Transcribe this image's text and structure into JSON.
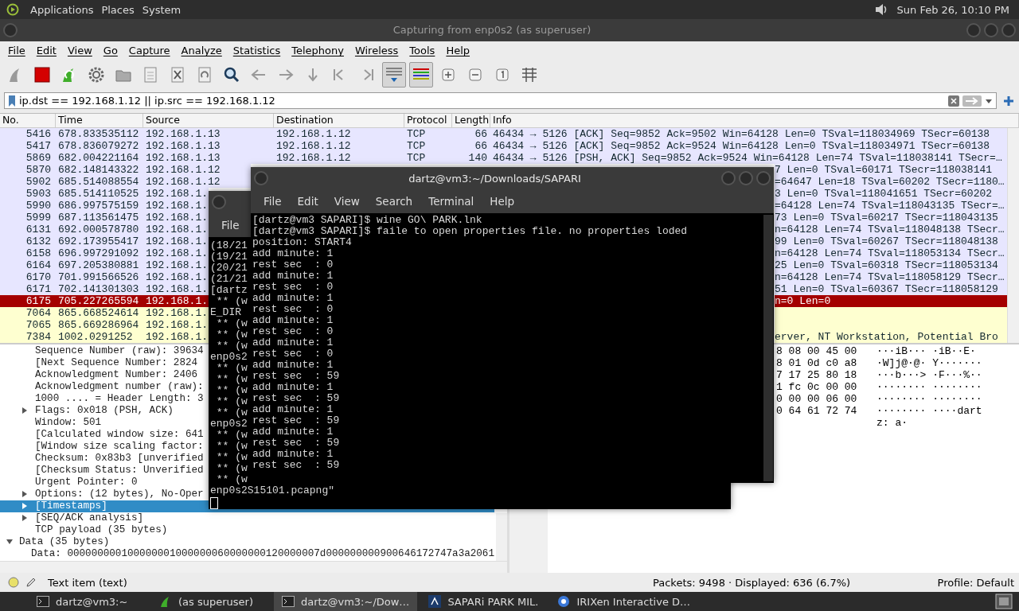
{
  "top_panel": {
    "menus": [
      "Applications",
      "Places",
      "System"
    ],
    "clock": "Sun Feb 26, 10:10 PM"
  },
  "window": {
    "title": "Capturing from enp0s2 (as superuser)"
  },
  "menu_bar": [
    "File",
    "Edit",
    "View",
    "Go",
    "Capture",
    "Analyze",
    "Statistics",
    "Telephony",
    "Wireless",
    "Tools",
    "Help"
  ],
  "toolbar": [
    {
      "kind": "fin",
      "on": false
    },
    {
      "kind": "stop",
      "on": false
    },
    {
      "kind": "restart",
      "on": false
    },
    {
      "kind": "gear",
      "on": false
    },
    {
      "kind": "folder",
      "on": false
    },
    {
      "kind": "file",
      "on": false
    },
    {
      "kind": "close",
      "on": false
    },
    {
      "kind": "reload",
      "on": false
    },
    {
      "kind": "search",
      "on": false
    },
    {
      "kind": "back",
      "on": false
    },
    {
      "kind": "forward",
      "on": false
    },
    {
      "kind": "jump",
      "on": false
    },
    {
      "kind": "first",
      "on": false
    },
    {
      "kind": "last",
      "on": false
    },
    {
      "kind": "autoscroll",
      "on": true
    },
    {
      "kind": "colorize",
      "on": true
    },
    {
      "kind": "zoom-in",
      "on": false
    },
    {
      "kind": "zoom-out",
      "on": false
    },
    {
      "kind": "normal",
      "on": false
    },
    {
      "kind": "columns",
      "on": false
    }
  ],
  "display_filter": {
    "value": "ip.dst == 192.168.1.12 || ip.src == 192.168.1.12"
  },
  "packet_list": {
    "columns": [
      "No.",
      "Time",
      "Source",
      "Destination",
      "Protocol",
      "Length",
      "Info"
    ],
    "rows": [
      {
        "no": "5416",
        "time": "678.833535112",
        "source": "192.168.1.13",
        "destination": "192.168.1.12",
        "protocol": "TCP",
        "length": "66",
        "info": "46434 → 5126 [ACK] Seq=9852 Ack=9502 Win=64128 Len=0 TSval=118034969 TSecr=60138",
        "color": "#e7e6ff",
        "selected": false
      },
      {
        "no": "5417",
        "time": "678.836079272",
        "source": "192.168.1.13",
        "destination": "192.168.1.12",
        "protocol": "TCP",
        "length": "66",
        "info": "46434 → 5126 [ACK] Seq=9852 Ack=9524 Win=64128 Len=0 TSval=118034971 TSecr=60138",
        "color": "#e7e6ff",
        "selected": false
      },
      {
        "no": "5869",
        "time": "682.004221164",
        "source": "192.168.1.13",
        "destination": "192.168.1.12",
        "protocol": "TCP",
        "length": "140",
        "info": "46434 → 5126 [PSH, ACK] Seq=9852 Ack=9524 Win=64128 Len=74 TSval=118038141 TSecr=…",
        "color": "#e7e6ff",
        "selected": false
      },
      {
        "no": "5870",
        "time": "682.148143322",
        "source": "192.168.1.12",
        "info_tail": "7 Len=0 TSval=60171 TSecr=118038141",
        "color": "#e7e6ff",
        "selected": false
      },
      {
        "no": "5902",
        "time": "685.514088554",
        "source": "192.168.1.12",
        "info_tail": "=64647 Len=18 TSval=60202 TSecr=1180…",
        "color": "#e7e6ff",
        "selected": false
      },
      {
        "no": "5903",
        "time": "685.514110525",
        "source": "192.168.1.",
        "info_tail": "3 Len=0 TSval=118041651 TSecr=60202",
        "color": "#e7e6ff",
        "selected": false
      },
      {
        "no": "5990",
        "time": "686.997575159",
        "source": "192.168.1.",
        "info_tail": "=64128 Len=74 TSval=118043135 TSecr=…",
        "color": "#e7e6ff",
        "selected": false
      },
      {
        "no": "5999",
        "time": "687.113561475",
        "source": "192.168.1.",
        "info_tail": "73 Len=0 TSval=60217 TSecr=118043135",
        "color": "#e7e6ff",
        "selected": false
      },
      {
        "no": "6131",
        "time": "692.000578780",
        "source": "192.168.1.",
        "info_tail": "n=64128 Len=74 TSval=118048138 TSecr…",
        "color": "#e7e6ff",
        "selected": false
      },
      {
        "no": "6132",
        "time": "692.173955417",
        "source": "192.168.1.",
        "info_tail": "99 Len=0 TSval=60267 TSecr=118048138",
        "color": "#e7e6ff",
        "selected": false
      },
      {
        "no": "6158",
        "time": "696.997291092",
        "source": "192.168.1.",
        "info_tail": "n=64128 Len=74 TSval=118053134 TSecr…",
        "color": "#e7e6ff",
        "selected": false
      },
      {
        "no": "6164",
        "time": "697.205380881",
        "source": "192.168.1.",
        "info_tail": "25 Len=0 TSval=60318 TSecr=118053134",
        "color": "#e7e6ff",
        "selected": false
      },
      {
        "no": "6170",
        "time": "701.991566526",
        "source": "192.168.1.",
        "info_tail": "n=64128 Len=74 TSval=118058129 TSecr…",
        "color": "#e7e6ff",
        "selected": false
      },
      {
        "no": "6171",
        "time": "702.141301303",
        "source": "192.168.1.",
        "info_tail": "51 Len=0 TSval=60367 TSecr=118058129",
        "color": "#e7e6ff",
        "selected": false
      },
      {
        "no": "6175",
        "time": "705.227265594",
        "source": "192.168.1.",
        "info_tail": "n=0 Len=0",
        "color": "#a40000",
        "selected": true
      },
      {
        "no": "7064",
        "time": "865.668524614",
        "source": "192.168.1.",
        "color": "#feffd0",
        "selected": false
      },
      {
        "no": "7065",
        "time": "865.669286964",
        "source": "192.168.1.",
        "color": "#feffd0",
        "selected": false
      },
      {
        "no": "7384",
        "time": "1002.0291252",
        "source": "192.168.1.",
        "info_tail": "erver, NT Workstation, Potential Bro",
        "color": "#feffd0",
        "selected": false
      }
    ]
  },
  "details": {
    "tcp_fields": [
      {
        "text": "Sequence Number (raw): 39634",
        "expandable": false,
        "selected": false
      },
      {
        "text": "[Next Sequence Number: 2824",
        "expandable": false,
        "selected": false
      },
      {
        "text": "Acknowledgment Number: 2406",
        "expandable": false,
        "selected": false
      },
      {
        "text": "Acknowledgment number (raw):",
        "expandable": false,
        "selected": false
      },
      {
        "text": "1000 .... = Header Length: 3",
        "expandable": false,
        "selected": false
      },
      {
        "text": "Flags: 0x018 (PSH, ACK)",
        "expandable": true,
        "selected": false
      },
      {
        "text": "Window: 501",
        "expandable": false,
        "selected": false
      },
      {
        "text": "[Calculated window size: 641",
        "expandable": false,
        "selected": false
      },
      {
        "text": "[Window size scaling factor:",
        "expandable": false,
        "selected": false
      },
      {
        "text": "Checksum: 0x83b3 [unverified",
        "expandable": false,
        "selected": false
      },
      {
        "text": "[Checksum Status: Unverified",
        "expandable": false,
        "selected": false
      },
      {
        "text": "Urgent Pointer: 0",
        "expandable": false,
        "selected": false
      },
      {
        "text": "Options: (12 bytes), No-Oper",
        "expandable": true,
        "selected": false
      },
      {
        "text": "[Timestamps]",
        "expandable": true,
        "selected": true
      },
      {
        "text": "[SEQ/ACK analysis]",
        "expandable": true,
        "selected": false
      },
      {
        "text": "TCP payload (35 bytes)",
        "expandable": false,
        "selected": false
      }
    ],
    "data_tree": {
      "text": "Data (35 bytes)",
      "expanded": true,
      "children": [
        {
          "text": "Data: 000000000100000001000000060000000120000007d000000000900646172747a3a2061"
        }
      ]
    }
  },
  "bytes": {
    "hex": [
      "8 08 00 45 00",
      "8 01 0d c0 a8",
      "7 17 25 80 18",
      "1 fc 0c 00 00",
      "0 00 00 06 00",
      "0 64 61 72 74"
    ],
    "ascii": [
      "···iB··· ·iB··E·",
      "·W]j@·@· Y·······",
      "···b···> ·F···%··",
      "········ ········",
      "········ ········",
      "········ ····dart",
      "z: a·"
    ]
  },
  "status_bar": {
    "item": "Text item (text)",
    "packets": "Packets: 9498 · Displayed: 636 (6.7%)",
    "profile": "Profile: Default"
  },
  "terminal_back": {
    "menus": [
      "File"
    ],
    "lines": [
      "(18/21",
      "(19/21",
      "(20/21",
      "(21/21",
      "[dartz",
      " ** (w",
      "E_DIR",
      " ** (w",
      " ** (w",
      " ** (w",
      "enp0s2",
      " ** (w",
      " ** (w",
      " ** (w",
      " ** (w",
      " ** (w",
      "enp0s2",
      " ** (w",
      " ** (w",
      " ** (w",
      " ** (w",
      " ** (w",
      "enp0s2S15101.pcapng\""
    ]
  },
  "terminal_front": {
    "title": "dartz@vm3:~/Downloads/SAPARI",
    "menus": [
      "File",
      "Edit",
      "View",
      "Search",
      "Terminal",
      "Help"
    ],
    "lines": [
      "[dartz@vm3 SAPARI]$ wine GO\\ PARK.lnk",
      "[dartz@vm3 SAPARI]$ faile to open properties file. no properties loded",
      "position: START4",
      "add minute: 1",
      "rest sec  : 0",
      "add minute: 1",
      "rest sec  : 0",
      "add minute: 1",
      "rest sec  : 0",
      "add minute: 1",
      "rest sec  : 0",
      "add minute: 1",
      "rest sec  : 0",
      "add minute: 1",
      "rest sec  : 59",
      "add minute: 1",
      "rest sec  : 59",
      "add minute: 1",
      "rest sec  : 59",
      "add minute: 1",
      "rest sec  : 59",
      "add minute: 1",
      "rest sec  : 59"
    ]
  },
  "taskbar": [
    {
      "kind": "terminal",
      "label": "dartz@vm3:~",
      "selected": false
    },
    {
      "kind": "fin",
      "label": "(as superuser)",
      "selected": false
    },
    {
      "kind": "terminal",
      "label": "dartz@vm3:~/Dow…",
      "selected": true
    },
    {
      "kind": "app",
      "label": "SAPARi PARK MIL.",
      "selected": false
    },
    {
      "kind": "browser",
      "label": "IRIXen Interactive D…",
      "selected": false
    }
  ]
}
